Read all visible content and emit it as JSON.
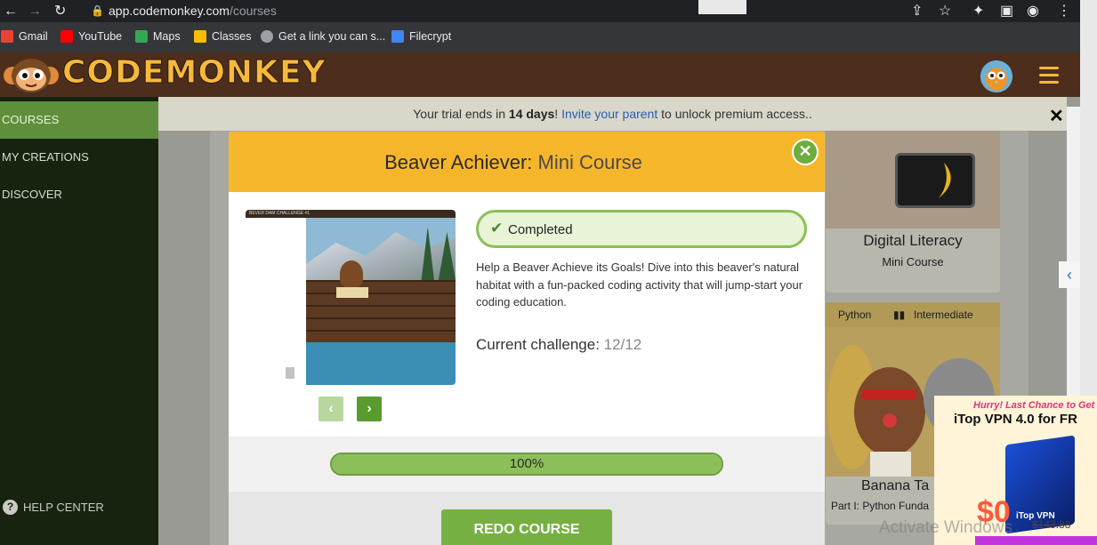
{
  "browser": {
    "url_host": "app.codemonkey.com",
    "url_path": "/courses",
    "bookmarks": [
      {
        "label": "Gmail",
        "color": "#ea4335"
      },
      {
        "label": "YouTube",
        "color": "#ff0000"
      },
      {
        "label": "Maps",
        "color": "#34a853"
      },
      {
        "label": "Classes",
        "color": "#fbbc04"
      },
      {
        "label": "Get a link you can s...",
        "color": "#9aa0a6"
      },
      {
        "label": "Filecrypt",
        "color": "#4285f4"
      }
    ]
  },
  "site": {
    "logo_text": "CODEMONKEY"
  },
  "sidebar": {
    "items": [
      {
        "label": "COURSES",
        "active": true
      },
      {
        "label": "MY CREATIONS",
        "active": false
      },
      {
        "label": "DISCOVER",
        "active": false
      }
    ],
    "help": "HELP CENTER"
  },
  "banner": {
    "prefix": "Your trial ends in ",
    "days": "14 days",
    "excl": "! ",
    "link": "Invite your parent",
    "suffix": " to unlock premium access.."
  },
  "background_cards": {
    "digital": {
      "title": "Digital Literacy",
      "subtitle": "Mini Course"
    },
    "banana": {
      "tag1": "Python",
      "tag2": "Intermediate",
      "title": "Banana Ta",
      "subtitle": "Part I: Python Funda"
    }
  },
  "modal": {
    "title_bold": "Beaver Achiever:",
    "title_light": " Mini Course",
    "preview_caption": "BEVER DAM CHALLENGE #1",
    "status": "Completed",
    "description": "Help a Beaver Achieve its Goals! Dive into this beaver's natural habitat with a fun-packed coding activity that will jump-start your coding education.",
    "challenge_label": "Current challenge:",
    "challenge_value": " 12/12",
    "progress_fraction": 1.0,
    "progress_label": "100%",
    "redo_label": "REDO COURSE"
  },
  "ad": {
    "hurry": "Hurry! Last Chance to Get",
    "title": "iTop VPN 4.0 for FR",
    "box_label": "iTop VPN",
    "price_new": "$0",
    "price_old": "$143.88"
  },
  "watermark": "Activate Windows",
  "colors": {
    "accent_green": "#76b042",
    "header_yellow": "#f6b62c",
    "site_brown": "#4d2e1d"
  }
}
